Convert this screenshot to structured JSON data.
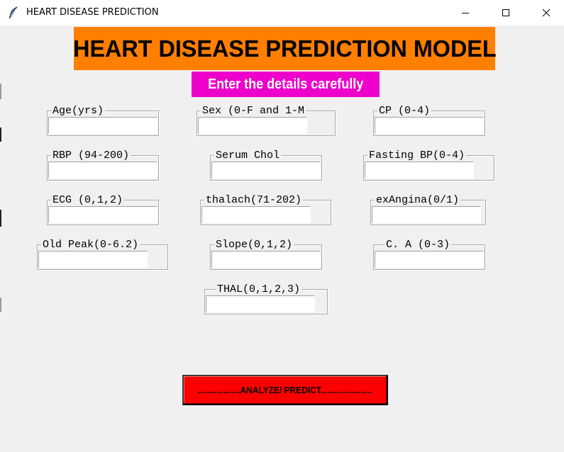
{
  "window": {
    "title": "HEART DISEASE PREDICTION",
    "icon": "feather-icon",
    "controls": [
      "minimize-icon",
      "maximize-icon",
      "close-icon"
    ]
  },
  "header": {
    "title": "HEART DISEASE PREDICTION MODEL",
    "background": "#ff7f00"
  },
  "subheader": {
    "text": "Enter the details carefully",
    "background": "#ee00cc",
    "color": "#ffffff"
  },
  "fields": {
    "age": {
      "label": "Age(yrs)",
      "value": ""
    },
    "sex": {
      "label": "Sex (0-F and 1-M",
      "value": ""
    },
    "cp": {
      "label": "CP (0-4)",
      "value": ""
    },
    "rbp": {
      "label": "RBP (94-200)",
      "value": ""
    },
    "serum_chol": {
      "label": "Serum Chol",
      "value": ""
    },
    "fasting_bp": {
      "label": "Fasting BP(0-4)",
      "value": ""
    },
    "ecg": {
      "label": "ECG (0,1,2)",
      "value": ""
    },
    "thalach": {
      "label": "thalach(71-202)",
      "value": ""
    },
    "exangina": {
      "label": "exAngina(0/1)",
      "value": ""
    },
    "old_peak": {
      "label": "Old Peak(0-6.2)",
      "value": ""
    },
    "slope": {
      "label": "Slope(0,1,2)",
      "value": ""
    },
    "ca": {
      "label": "C. A (0-3)",
      "value": ""
    },
    "thal": {
      "label": "THAL(0,1,2,3)",
      "value": ""
    }
  },
  "predict_button": {
    "label": "..................ANALYZE/ PREDICT......................",
    "background": "#ff0000"
  }
}
